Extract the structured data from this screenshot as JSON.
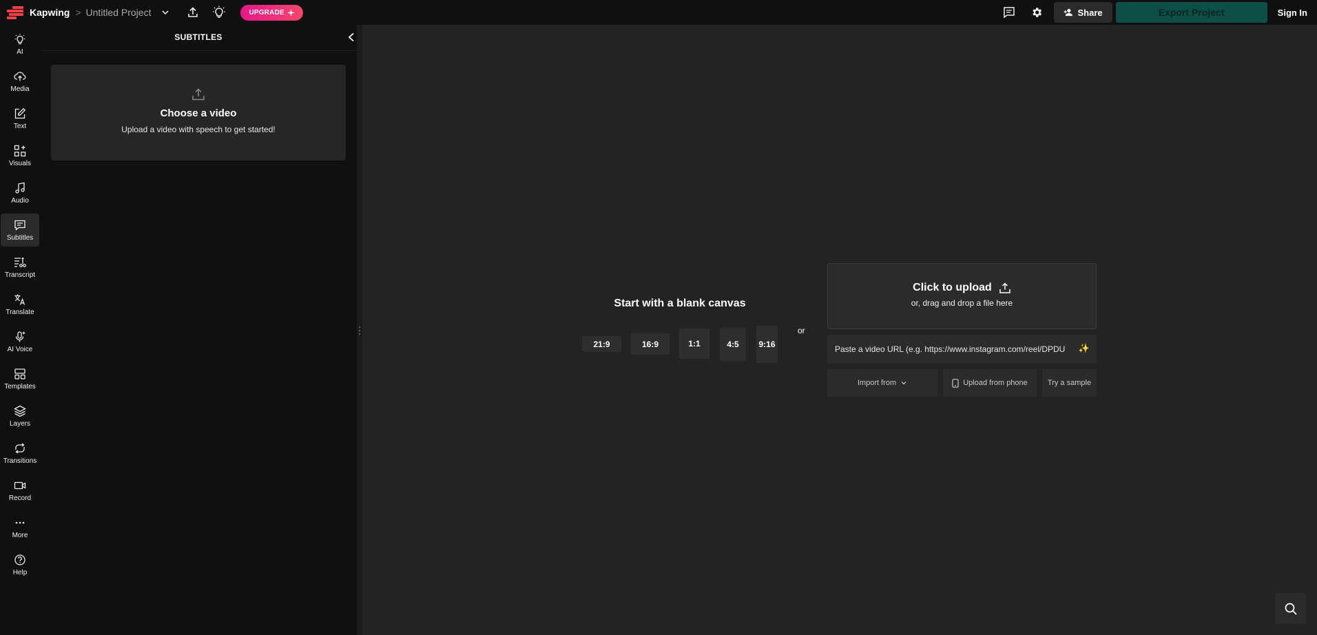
{
  "header": {
    "brand": "Kapwing",
    "breadcrumb_sep": ">",
    "project_title": "Untitled Project",
    "upgrade_label": "UPGRADE",
    "share_label": "Share",
    "export_label": "Export Project",
    "signin_label": "Sign In"
  },
  "rail": {
    "items": [
      {
        "label": "AI",
        "icon": "bulb-icon"
      },
      {
        "label": "Media",
        "icon": "cloud-upload-icon"
      },
      {
        "label": "Text",
        "icon": "edit-icon"
      },
      {
        "label": "Visuals",
        "icon": "shapes-icon"
      },
      {
        "label": "Audio",
        "icon": "music-note-icon"
      },
      {
        "label": "Subtitles",
        "icon": "subtitles-icon"
      },
      {
        "label": "Transcript",
        "icon": "transcript-icon"
      },
      {
        "label": "Translate",
        "icon": "translate-icon"
      },
      {
        "label": "AI Voice",
        "icon": "ai-voice-icon"
      },
      {
        "label": "Templates",
        "icon": "templates-icon"
      },
      {
        "label": "Layers",
        "icon": "layers-icon"
      },
      {
        "label": "Transitions",
        "icon": "transitions-icon"
      },
      {
        "label": "Record",
        "icon": "camera-icon"
      },
      {
        "label": "More",
        "icon": "more-icon"
      },
      {
        "label": "Help",
        "icon": "help-icon"
      }
    ],
    "active": "Subtitles"
  },
  "panel": {
    "title": "SUBTITLES",
    "card_title": "Choose a video",
    "card_subtitle": "Upload a video with speech to get started!"
  },
  "canvas": {
    "blank_title": "Start with a blank canvas",
    "ratios": [
      "21:9",
      "16:9",
      "1:1",
      "4:5",
      "9:16"
    ],
    "or": "or",
    "upload_title": "Click to upload",
    "upload_subtitle": "or, drag and drop a file here",
    "url_placeholder": "Paste a video URL (e.g. https://www.instagram.com/reel/DPDU",
    "import_label": "Import from",
    "phone_label": "Upload from phone",
    "sample_label": "Try a sample"
  },
  "colors": {
    "upgrade_start": "#e8178d",
    "upgrade_end": "#f4456a",
    "export_bg": "#0c4f46",
    "logo": "#ee4247"
  }
}
